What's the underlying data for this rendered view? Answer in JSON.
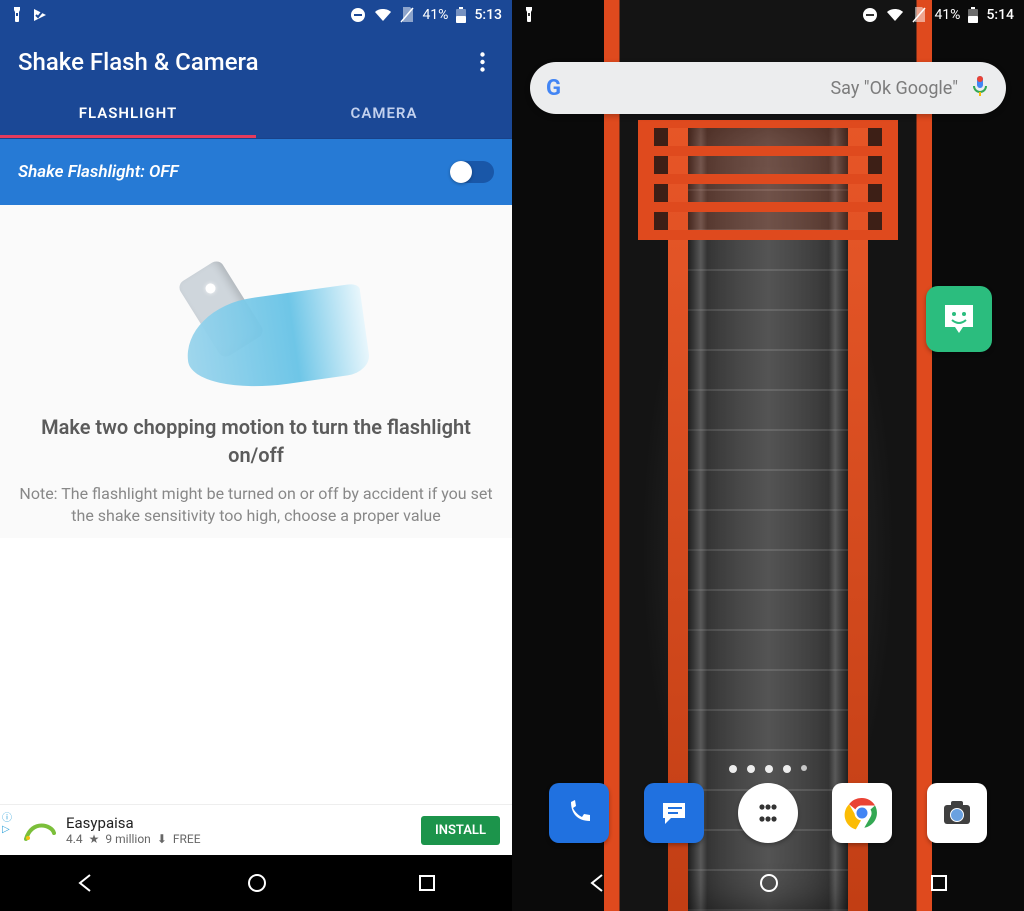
{
  "left": {
    "status": {
      "battery": "41%",
      "clock": "5:13"
    },
    "app_title": "Shake Flash & Camera",
    "tabs": {
      "flashlight": "FLASHLIGHT",
      "camera": "CAMERA"
    },
    "toggle_label": "Shake Flashlight: OFF",
    "headline": "Make two chopping motion to turn the flashlight on/off",
    "note": "Note: The flashlight might be turned on or off by accident if you set the shake sensitivity too high, choose a proper value",
    "ad": {
      "title": "Easypaisa",
      "rating": "4.4",
      "downloads": "9 million",
      "price": "FREE",
      "cta": "INSTALL"
    }
  },
  "right": {
    "status": {
      "battery": "41%",
      "clock": "5:14"
    },
    "search_hint": "Say \"Ok Google\"",
    "app_bitmoji": "Bitmoji"
  }
}
